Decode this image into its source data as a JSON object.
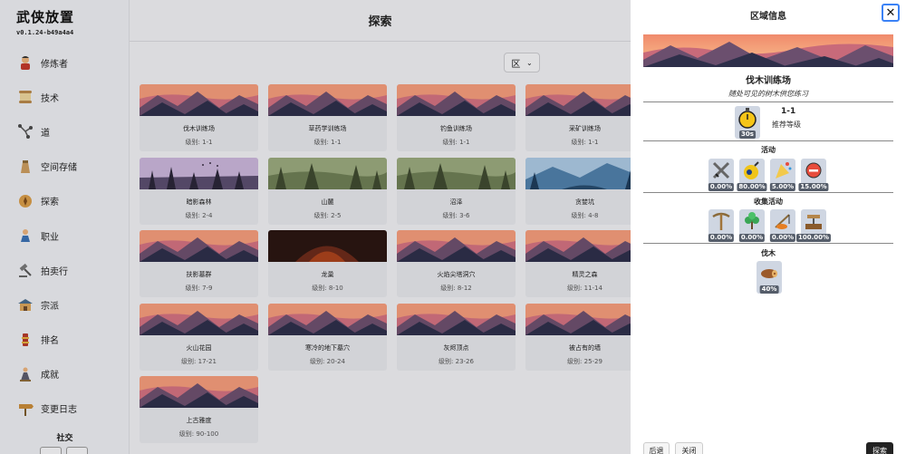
{
  "app": {
    "title": "武侠放置",
    "version": "v0.1.24-b49a4a4"
  },
  "sidebar": {
    "items": [
      {
        "label": "修炼者",
        "icon": "cultivator-icon"
      },
      {
        "label": "技术",
        "icon": "scroll-icon"
      },
      {
        "label": "道",
        "icon": "path-icon"
      },
      {
        "label": "空间存储",
        "icon": "bag-icon"
      },
      {
        "label": "探索",
        "icon": "explore-icon"
      },
      {
        "label": "职业",
        "icon": "job-icon"
      },
      {
        "label": "拍卖行",
        "icon": "gavel-icon"
      },
      {
        "label": "宗派",
        "icon": "sect-icon"
      },
      {
        "label": "排名",
        "icon": "ranking-icon"
      },
      {
        "label": "成就",
        "icon": "achievement-icon"
      },
      {
        "label": "变更日志",
        "icon": "changelog-icon"
      }
    ],
    "social_label": "社交"
  },
  "main": {
    "title": "探索",
    "region_select": "区",
    "cards": [
      {
        "name": "伐木训练场",
        "level": "级别:  1-1",
        "scene": "sunset"
      },
      {
        "name": "草药学训练场",
        "level": "级别:  1-1",
        "scene": "sunset"
      },
      {
        "name": "钓鱼训练场",
        "level": "级别:  1-1",
        "scene": "sunset"
      },
      {
        "name": "采矿训练场",
        "level": "级别:  1-1",
        "scene": "sunset"
      },
      {
        "name": "暗影森林",
        "level": "级别:  2-4",
        "scene": "purple"
      },
      {
        "name": "山麓",
        "level": "级别:  2-5",
        "scene": "green"
      },
      {
        "name": "沼泽",
        "level": "级别:  3-6",
        "scene": "green"
      },
      {
        "name": "贪婪坑",
        "level": "级别:  4-8",
        "scene": "blue"
      },
      {
        "name": "扶影墓群",
        "level": "级别:  7-9",
        "scene": "sunset"
      },
      {
        "name": "龙巢",
        "level": "级别:  8-10",
        "scene": "cave"
      },
      {
        "name": "火焰尖塔洞穴",
        "level": "级别:  8-12",
        "scene": "sunset"
      },
      {
        "name": "精灵之森",
        "level": "级别:  11-14",
        "scene": "sunset"
      },
      {
        "name": "火山花园",
        "level": "级别:  17-21",
        "scene": "sunset"
      },
      {
        "name": "寒冷的地下墓穴",
        "level": "级别:  20-24",
        "scene": "sunset"
      },
      {
        "name": "灰烬顶点",
        "level": "级别:  23-26",
        "scene": "sunset"
      },
      {
        "name": "被占有的墙",
        "level": "级别:  25-29",
        "scene": "sunset"
      },
      {
        "name": "上古雅度",
        "level": "级别:  90-100",
        "scene": "sunset"
      }
    ]
  },
  "panel": {
    "title": "区域信息",
    "area_name": "伐木训练场",
    "area_desc": "随处可见的树木供您练习",
    "duration": "30s",
    "level_code": "1-1",
    "level_label": "推荐等级",
    "activities_title": "活动",
    "activities": [
      {
        "icon": "swords-icon",
        "pct": "0.00%"
      },
      {
        "icon": "bomb-icon",
        "pct": "80.00%"
      },
      {
        "icon": "party-icon",
        "pct": "5.00%"
      },
      {
        "icon": "stop-icon",
        "pct": "15.00%"
      }
    ],
    "gathering_title": "收集活动",
    "gathering": [
      {
        "icon": "pickaxe-icon",
        "pct": "0.00%"
      },
      {
        "icon": "herb-icon",
        "pct": "0.00%"
      },
      {
        "icon": "fishing-icon",
        "pct": "0.00%"
      },
      {
        "icon": "lumber-icon",
        "pct": "100.00%"
      }
    ],
    "lumber_title": "伐木",
    "lumber": [
      {
        "icon": "log-icon",
        "pct": "40%"
      }
    ],
    "back_label": "后退",
    "close_label": "关闭",
    "explore_label": "探索"
  }
}
